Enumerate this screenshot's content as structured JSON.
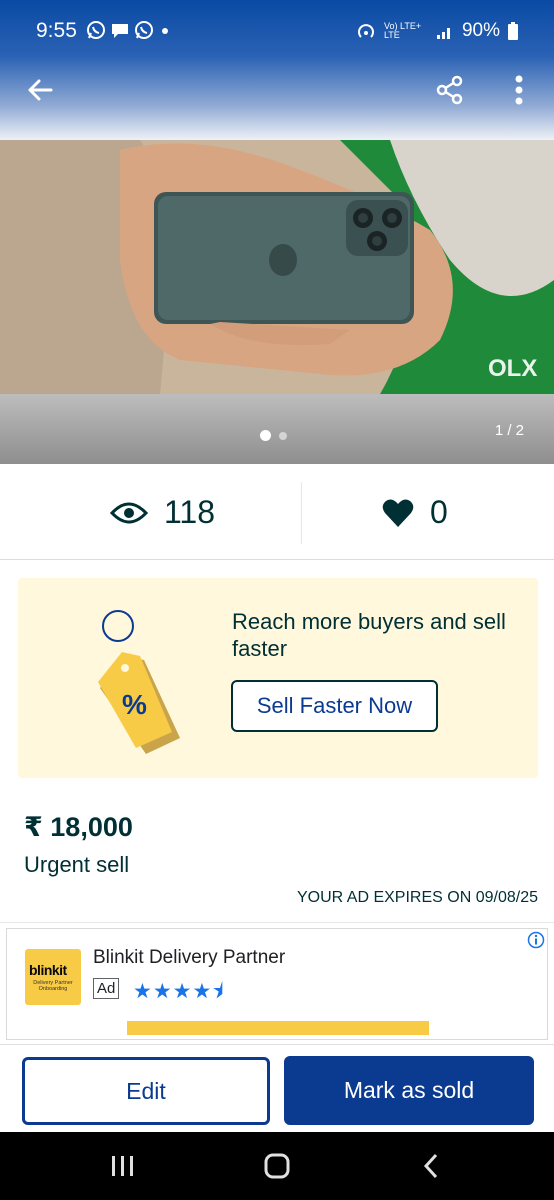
{
  "status_bar": {
    "time": "9:55",
    "notification_icons": [
      "whatsapp-icon",
      "chat-bubble-icon",
      "whatsapp-icon",
      "dot-icon"
    ],
    "network": "Vo) LTE+ LTE",
    "battery": "90%"
  },
  "app_bar": {
    "back_icon": "arrow-left-icon",
    "share_icon": "share-icon",
    "more_icon": "more-vertical-icon"
  },
  "gallery": {
    "watermark": "OLX",
    "page_counter": "1 / 2",
    "current_page": 1,
    "total_pages": 2
  },
  "stats": {
    "views": "118",
    "likes": "0"
  },
  "promo": {
    "headline": "Reach more buyers and sell faster",
    "button_label": "Sell Faster Now",
    "tag_symbol": "%"
  },
  "listing": {
    "price": "₹ 18,000",
    "title": "Urgent sell",
    "expiry": "YOUR AD EXPIRES ON 09/08/25"
  },
  "sponsored": {
    "brand_logo_text": "blinkit",
    "brand_logo_subtext": "Delivery Partner Onboarding",
    "name": "Blinkit Delivery Partner",
    "badge": "Ad",
    "rating": 4.5,
    "rating_stars": "★★★★⯨"
  },
  "actions": {
    "edit_label": "Edit",
    "mark_sold_label": "Mark as sold"
  },
  "colors": {
    "primary": "#0b3b91",
    "text_dark": "#002f34",
    "promo_bg": "#fff8dc",
    "tag_yellow": "#f8cb46",
    "header_blue": "#0a4aa4"
  }
}
